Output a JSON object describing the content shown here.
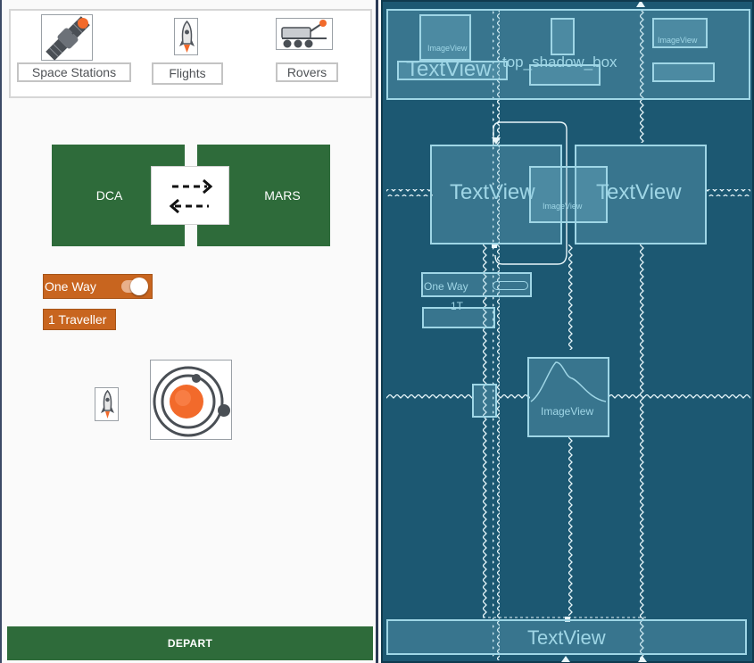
{
  "design": {
    "tabs": [
      {
        "label": "Space Stations",
        "icon": "satellite-icon"
      },
      {
        "label": "Flights",
        "icon": "rocket-icon"
      },
      {
        "label": "Rovers",
        "icon": "rover-icon"
      }
    ],
    "origin": "DCA",
    "destination": "MARS",
    "swap_icon": "swap-arrows-icon",
    "trip_toggle": {
      "label": "One Way",
      "on": true
    },
    "travellers_label": "1 Traveller",
    "small_icon": "rocket-icon",
    "galaxy_icon": "solar-system-icon",
    "depart_label": "DEPART",
    "colors": {
      "primary": "#2e6b3a",
      "accent": "#c8651f",
      "blueprint": "#1c5872"
    }
  },
  "blueprint": {
    "labels": {
      "top_left_text": "TextView",
      "top_box": "top_shadow_box",
      "left_text": "TextView",
      "right_text": "TextView",
      "image_view": "ImageView",
      "switch": "One Way",
      "switch_sub": "1T",
      "bottom_text": "TextView"
    }
  }
}
